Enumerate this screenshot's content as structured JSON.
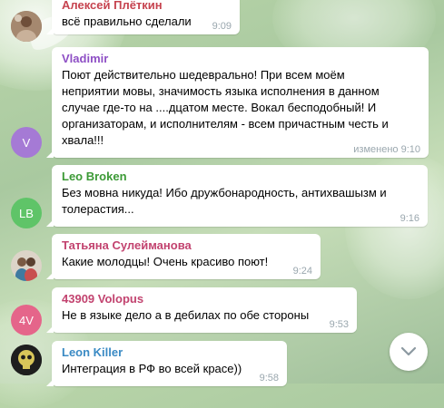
{
  "messages": [
    {
      "sender": "Алексей Плёткин",
      "sender_color": "#c6434f",
      "lines": [
        "всё правильно сделали"
      ],
      "time": "9:09",
      "avatar": {
        "type": "photo",
        "icon": "user-photo-icon"
      }
    },
    {
      "sender": "Vladimir",
      "sender_color": "#8e4fc5",
      "lines": [
        "Поют действительно шедеврально! При всем моём",
        "неприятии мовы, значимость языка исполнения в данном",
        "случае где-то на ....дцатом месте. Вокал бесподобный! И",
        "организаторам, и исполнителям - всем причастным честь и",
        "хвала!!!"
      ],
      "time": "изменено 9:10",
      "avatar": {
        "type": "initials",
        "initials": "V",
        "color": "#a57ad5"
      }
    },
    {
      "sender": "Leo Broken",
      "sender_color": "#3c9a36",
      "lines": [
        "Без мовна никуда! Ибо дружбонародность, антихвашызм и",
        "толерастия..."
      ],
      "time": "9:16",
      "avatar": {
        "type": "initials",
        "initials": "LB",
        "color": "#5fc468"
      }
    },
    {
      "sender": "Татьяна Сулейманова",
      "sender_color": "#c2436f",
      "lines": [
        "Какие молодцы! Очень красиво поют!"
      ],
      "time": "9:24",
      "avatar": {
        "type": "photo",
        "icon": "user-photo-icon"
      }
    },
    {
      "sender": "43909 Volopus",
      "sender_color": "#c2436f",
      "lines": [
        "Не в языке дело а в дебилах по  обе стороны"
      ],
      "time": "9:53",
      "avatar": {
        "type": "initials",
        "initials": "4V",
        "color": "#e5658a"
      }
    },
    {
      "sender": "Leon Killer",
      "sender_color": "#3a8ac4",
      "lines": [
        "Интеграция в РФ во всей красе))"
      ],
      "time": "9:58",
      "avatar": {
        "type": "photo",
        "icon": "skull-photo-icon"
      }
    }
  ],
  "scroll_down": {
    "icon": "chevron-down-icon"
  }
}
